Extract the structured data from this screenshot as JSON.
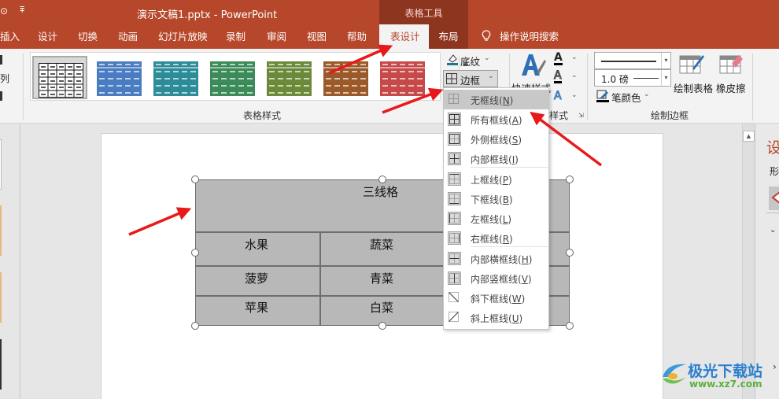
{
  "window": {
    "title": "演示文稿1.pptx  -  PowerPoint",
    "context_group": "表格工具"
  },
  "tabs": [
    {
      "label": "插入"
    },
    {
      "label": "设计"
    },
    {
      "label": "切换"
    },
    {
      "label": "动画"
    },
    {
      "label": "幻灯片放映"
    },
    {
      "label": "录制"
    },
    {
      "label": "审阅"
    },
    {
      "label": "视图"
    },
    {
      "label": "帮助"
    },
    {
      "label": "表设计",
      "active": true
    },
    {
      "label": "布局"
    }
  ],
  "search": {
    "label": "操作说明搜索"
  },
  "ribbon": {
    "left_cut": {
      "item": "列"
    },
    "table_styles": {
      "group_label": "表格样式",
      "thumbnails": [
        {
          "name": "plain-grid",
          "color": "#ffffff",
          "selected": true
        },
        {
          "name": "blue",
          "color": "#4a7cc2"
        },
        {
          "name": "teal",
          "color": "#2e8c99"
        },
        {
          "name": "green",
          "color": "#3d8a5a"
        },
        {
          "name": "olive",
          "color": "#6b8a3a"
        },
        {
          "name": "brown",
          "color": "#9b5a2a"
        },
        {
          "name": "red",
          "color": "#c74a4a"
        }
      ],
      "shading_label": "底纹",
      "border_label": "边框"
    },
    "wordart": {
      "quick_styles_label": "快速样式",
      "group_label_tail": "样式"
    },
    "draw_borders": {
      "group_label": "绘制边框",
      "pen_weight": "1.0 磅",
      "pen_color_label": "笔颜色",
      "draw_table_label": "绘制表格",
      "eraser_label": "橡皮擦"
    }
  },
  "border_menu": {
    "items": [
      {
        "label": "无框线",
        "key": "N",
        "highlighted": true,
        "icon": "no-border-icon"
      },
      {
        "label": "所有框线",
        "key": "A",
        "icon": "all-borders-icon"
      },
      {
        "label": "外侧框线",
        "key": "S",
        "icon": "outside-borders-icon"
      },
      {
        "label": "内部框线",
        "key": "I",
        "icon": "inside-borders-icon"
      },
      {
        "label": "上框线",
        "key": "P",
        "icon": "top-border-icon"
      },
      {
        "label": "下框线",
        "key": "B",
        "icon": "bottom-border-icon"
      },
      {
        "label": "左框线",
        "key": "L",
        "icon": "left-border-icon"
      },
      {
        "label": "右框线",
        "key": "R",
        "icon": "right-border-icon"
      },
      {
        "label": "内部横框线",
        "key": "H",
        "icon": "inside-horizontal-border-icon"
      },
      {
        "label": "内部竖框线",
        "key": "V",
        "icon": "inside-vertical-border-icon"
      },
      {
        "label": "斜下框线",
        "key": "W",
        "icon": "diagonal-down-border-icon"
      },
      {
        "label": "斜上框线",
        "key": "U",
        "icon": "diagonal-up-border-icon"
      }
    ]
  },
  "table": {
    "title": "三线格",
    "rows": [
      [
        "水果",
        "蔬菜"
      ],
      [
        "菠萝",
        "青菜"
      ],
      [
        "苹果",
        "白菜"
      ]
    ]
  },
  "right_pane": {
    "title_char": "设",
    "sub_char": "形"
  },
  "watermark": {
    "brand": "极光下载站",
    "url": "www.xz7.com"
  },
  "colors": {
    "accent": "#b7472a",
    "context_tab": "#8e3520",
    "annotation_arrow": "#e8191a"
  }
}
